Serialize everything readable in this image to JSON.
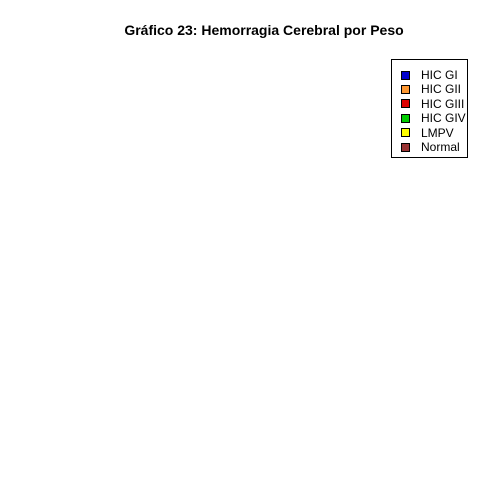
{
  "chart_data": {
    "type": "bar",
    "title": "Gráfico 23: Hemorragia Cerebral por Peso",
    "categories": [],
    "series": [
      {
        "name": "HIC GI",
        "color": "#0000cc",
        "values": []
      },
      {
        "name": "HIC GII",
        "color": "#ff9933",
        "values": []
      },
      {
        "name": "HIC GIII",
        "color": "#dd0000",
        "values": []
      },
      {
        "name": "HIC GIV",
        "color": "#00cc00",
        "values": []
      },
      {
        "name": "LMPV",
        "color": "#ffff00",
        "values": []
      },
      {
        "name": "Normal",
        "color": "#993333",
        "values": []
      }
    ],
    "legend_position": "top-right",
    "grid": false
  }
}
